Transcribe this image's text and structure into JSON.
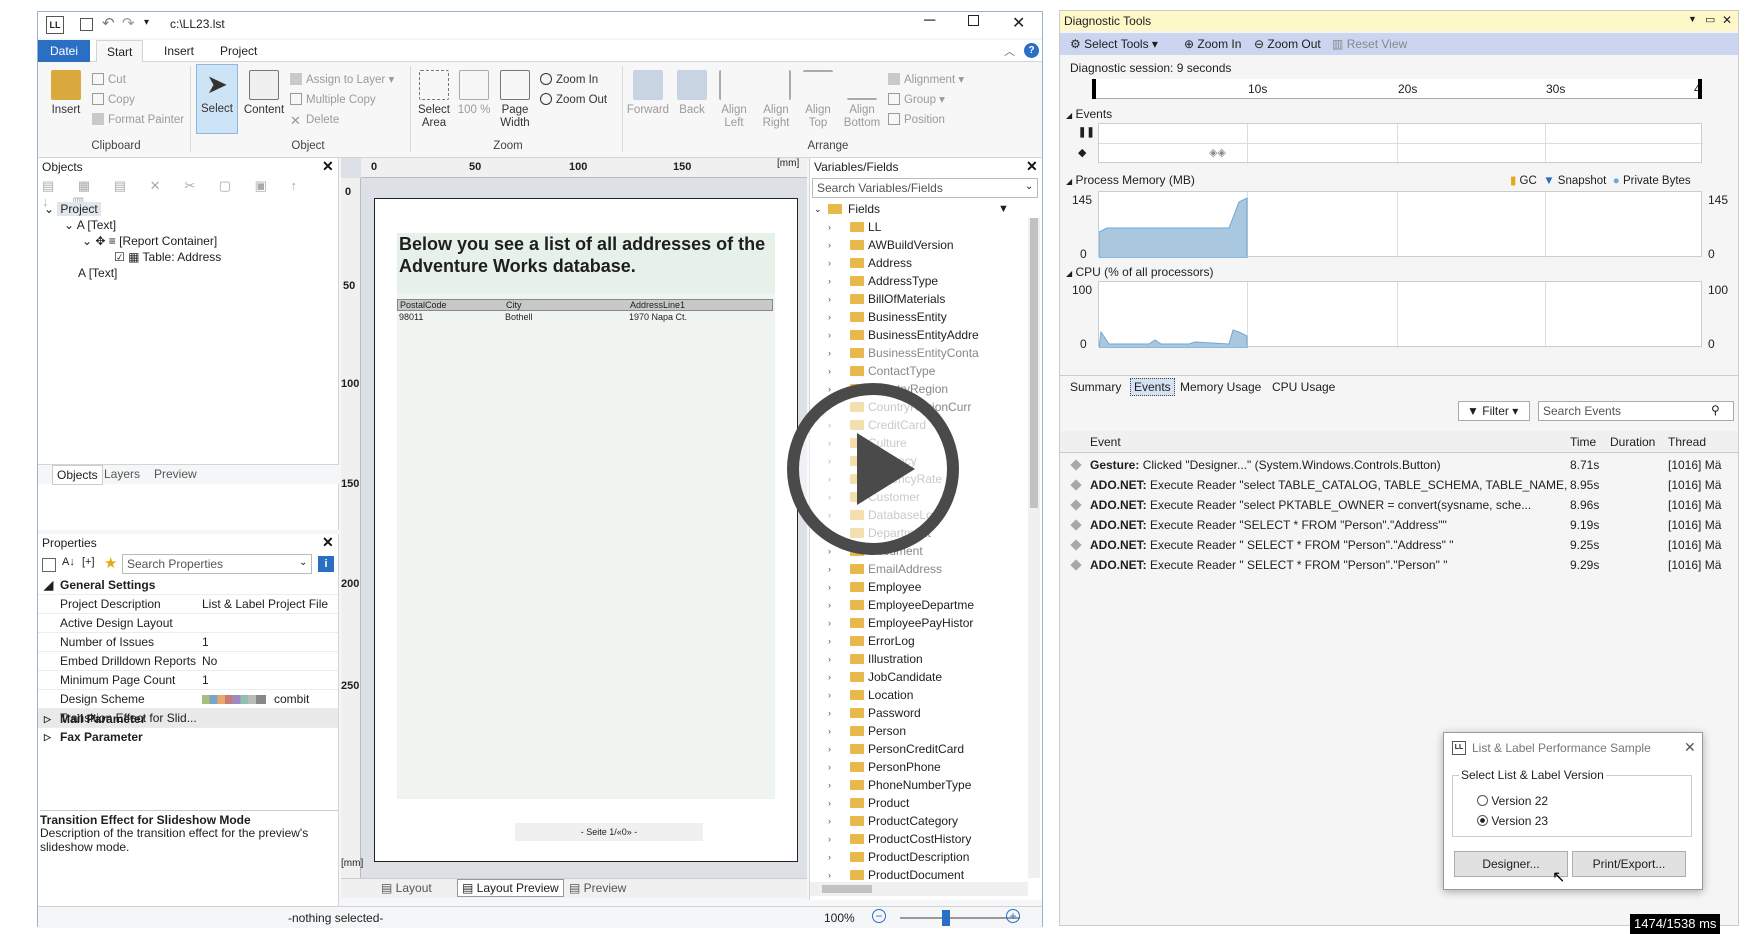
{
  "app": {
    "path_title": "c:\\LL23.lst",
    "ribbon_tabs": [
      "Datei",
      "Start",
      "Insert",
      "Project"
    ],
    "clipboard": {
      "insert": "Insert",
      "cut": "Cut",
      "copy": "Copy",
      "format_painter": "Format Painter",
      "group": "Clipboard"
    },
    "object": {
      "select": "Select",
      "content": "Content",
      "assign_layer": "Assign to Layer",
      "multiple_copy": "Multiple Copy",
      "delete": "Delete",
      "group": "Object"
    },
    "zoom": {
      "select_area": "Select Area",
      "pct": "100 %",
      "page_width": "Page Width",
      "zoom_in": "Zoom In",
      "zoom_out": "Zoom Out",
      "group": "Zoom"
    },
    "arrange": {
      "forward": "Forward",
      "back": "Back",
      "align_left": "Align Left",
      "align_right": "Align Right",
      "align_top": "Align Top",
      "align_bottom": "Align Bottom",
      "alignment": "Alignment",
      "group_btn": "Group",
      "position": "Position",
      "group": "Arrange"
    }
  },
  "objects_panel": {
    "title": "Objects",
    "tree": [
      "Project",
      "[Text]",
      "[Report Container]",
      "Table: Address",
      "[Text]"
    ],
    "tabs": [
      "Objects",
      "Layers",
      "Preview"
    ]
  },
  "properties": {
    "title": "Properties",
    "search_placeholder": "Search Properties",
    "group": "General Settings",
    "rows": [
      {
        "name": "Project Description",
        "value": "List & Label Project File"
      },
      {
        "name": "Active Design Layout",
        "value": ""
      },
      {
        "name": "Number of Issues",
        "value": "1"
      },
      {
        "name": "Embed Drilldown Reports",
        "value": "No"
      },
      {
        "name": "Minimum Page Count",
        "value": "1"
      },
      {
        "name": "Design Scheme",
        "value": "combit"
      },
      {
        "name": "Transition Effect for Slid...",
        "value": ""
      }
    ],
    "collapsed_groups": [
      "Mail Parameter",
      "Fax Parameter"
    ],
    "help_title": "Transition Effect for Slideshow Mode",
    "help_text": "Description of the transition effect for the preview's slideshow mode."
  },
  "canvas": {
    "ruler_top": [
      "0",
      "50",
      "100",
      "150",
      "[mm]"
    ],
    "ruler_left": [
      "0",
      "50",
      "100",
      "150",
      "200",
      "250",
      "[mm]"
    ],
    "heading": "Below you see a list of all addresses of the Adventure Works database.",
    "table_headers": [
      "PostalCode",
      "City",
      "AddressLine1"
    ],
    "table_row": [
      "98011",
      "Bothell",
      "1970 Napa Ct."
    ],
    "footer": "- Seite 1/«0» -",
    "bottom_tabs": [
      "Layout",
      "Layout Preview",
      "Preview"
    ]
  },
  "variables": {
    "title": "Variables/Fields",
    "search_placeholder": "Search Variables/Fields",
    "root": "Fields",
    "items": [
      "LL",
      "AWBuildVersion",
      "Address",
      "AddressType",
      "BillOfMaterials",
      "BusinessEntity",
      "BusinessEntityAddre",
      "BusinessEntityConta",
      "ContactType",
      "CountryRegion",
      "CountryRegionCurr",
      "CreditCard",
      "Culture",
      "Currency",
      "CurrencyRate",
      "Customer",
      "DatabaseLog",
      "Department",
      "Document",
      "EmailAddress",
      "Employee",
      "EmployeeDepartme",
      "EmployeePayHistor",
      "ErrorLog",
      "Illustration",
      "JobCandidate",
      "Location",
      "Password",
      "Person",
      "PersonCreditCard",
      "PersonPhone",
      "PhoneNumberType",
      "Product",
      "ProductCategory",
      "ProductCostHistory",
      "ProductDescription",
      "ProductDocument"
    ]
  },
  "status": {
    "selection": "-nothing selected-",
    "zoom": "100%"
  },
  "diag": {
    "title": "Diagnostic Tools",
    "toolbar": [
      "Select Tools",
      "Zoom In",
      "Zoom Out",
      "Reset View"
    ],
    "session": "Diagnostic session: 9 seconds",
    "timeline_ticks": [
      "10s",
      "20s",
      "30s",
      "4"
    ],
    "events_label": "Events",
    "memory_label": "Process Memory (MB)",
    "memory_legend": [
      "GC",
      "Snapshot",
      "Private Bytes"
    ],
    "memory_axis": [
      "145",
      "0",
      "145",
      "0"
    ],
    "cpu_label": "CPU (% of all processors)",
    "cpu_axis": [
      "100",
      "0",
      "100",
      "0"
    ],
    "tabs": [
      "Summary",
      "Events",
      "Memory Usage",
      "CPU Usage"
    ],
    "filter": "Filter",
    "search_placeholder": "Search Events",
    "columns": [
      "Event",
      "Time",
      "Duration",
      "Thread"
    ],
    "events": [
      {
        "kind": "Gesture:",
        "text": " Clicked \"Designer...\" (System.Windows.Controls.Button)",
        "time": "8.71s",
        "thread": "[1016] Mä"
      },
      {
        "kind": "ADO.NET:",
        "text": " Execute Reader \"select TABLE_CATALOG, TABLE_SCHEMA, TABLE_NAME, TAB...",
        "time": "8.95s",
        "thread": "[1016] Mä"
      },
      {
        "kind": "ADO.NET:",
        "text": " Execute Reader \"select                PKTABLE_OWNER = convert(sysname, sche...",
        "time": "8.96s",
        "thread": "[1016] Mä"
      },
      {
        "kind": "ADO.NET:",
        "text": " Execute Reader \"SELECT * FROM \"Person\".\"Address\"\"",
        "time": "9.19s",
        "thread": "[1016] Mä"
      },
      {
        "kind": "ADO.NET:",
        "text": " Execute Reader \" SELECT * FROM \"Person\".\"Address\" \"",
        "time": "9.25s",
        "thread": "[1016] Mä"
      },
      {
        "kind": "ADO.NET:",
        "text": " Execute Reader \" SELECT * FROM \"Person\".\"Person\" \"",
        "time": "9.29s",
        "thread": "[1016] Mä"
      }
    ]
  },
  "sample_dialog": {
    "title": "List & Label Performance Sample",
    "group": "Select List & Label Version",
    "options": [
      "Version 22",
      "Version 23"
    ],
    "selected": "Version 23",
    "buttons": [
      "Designer...",
      "Print/Export..."
    ]
  },
  "overlay": {
    "timer": "1474/1538 ms"
  }
}
